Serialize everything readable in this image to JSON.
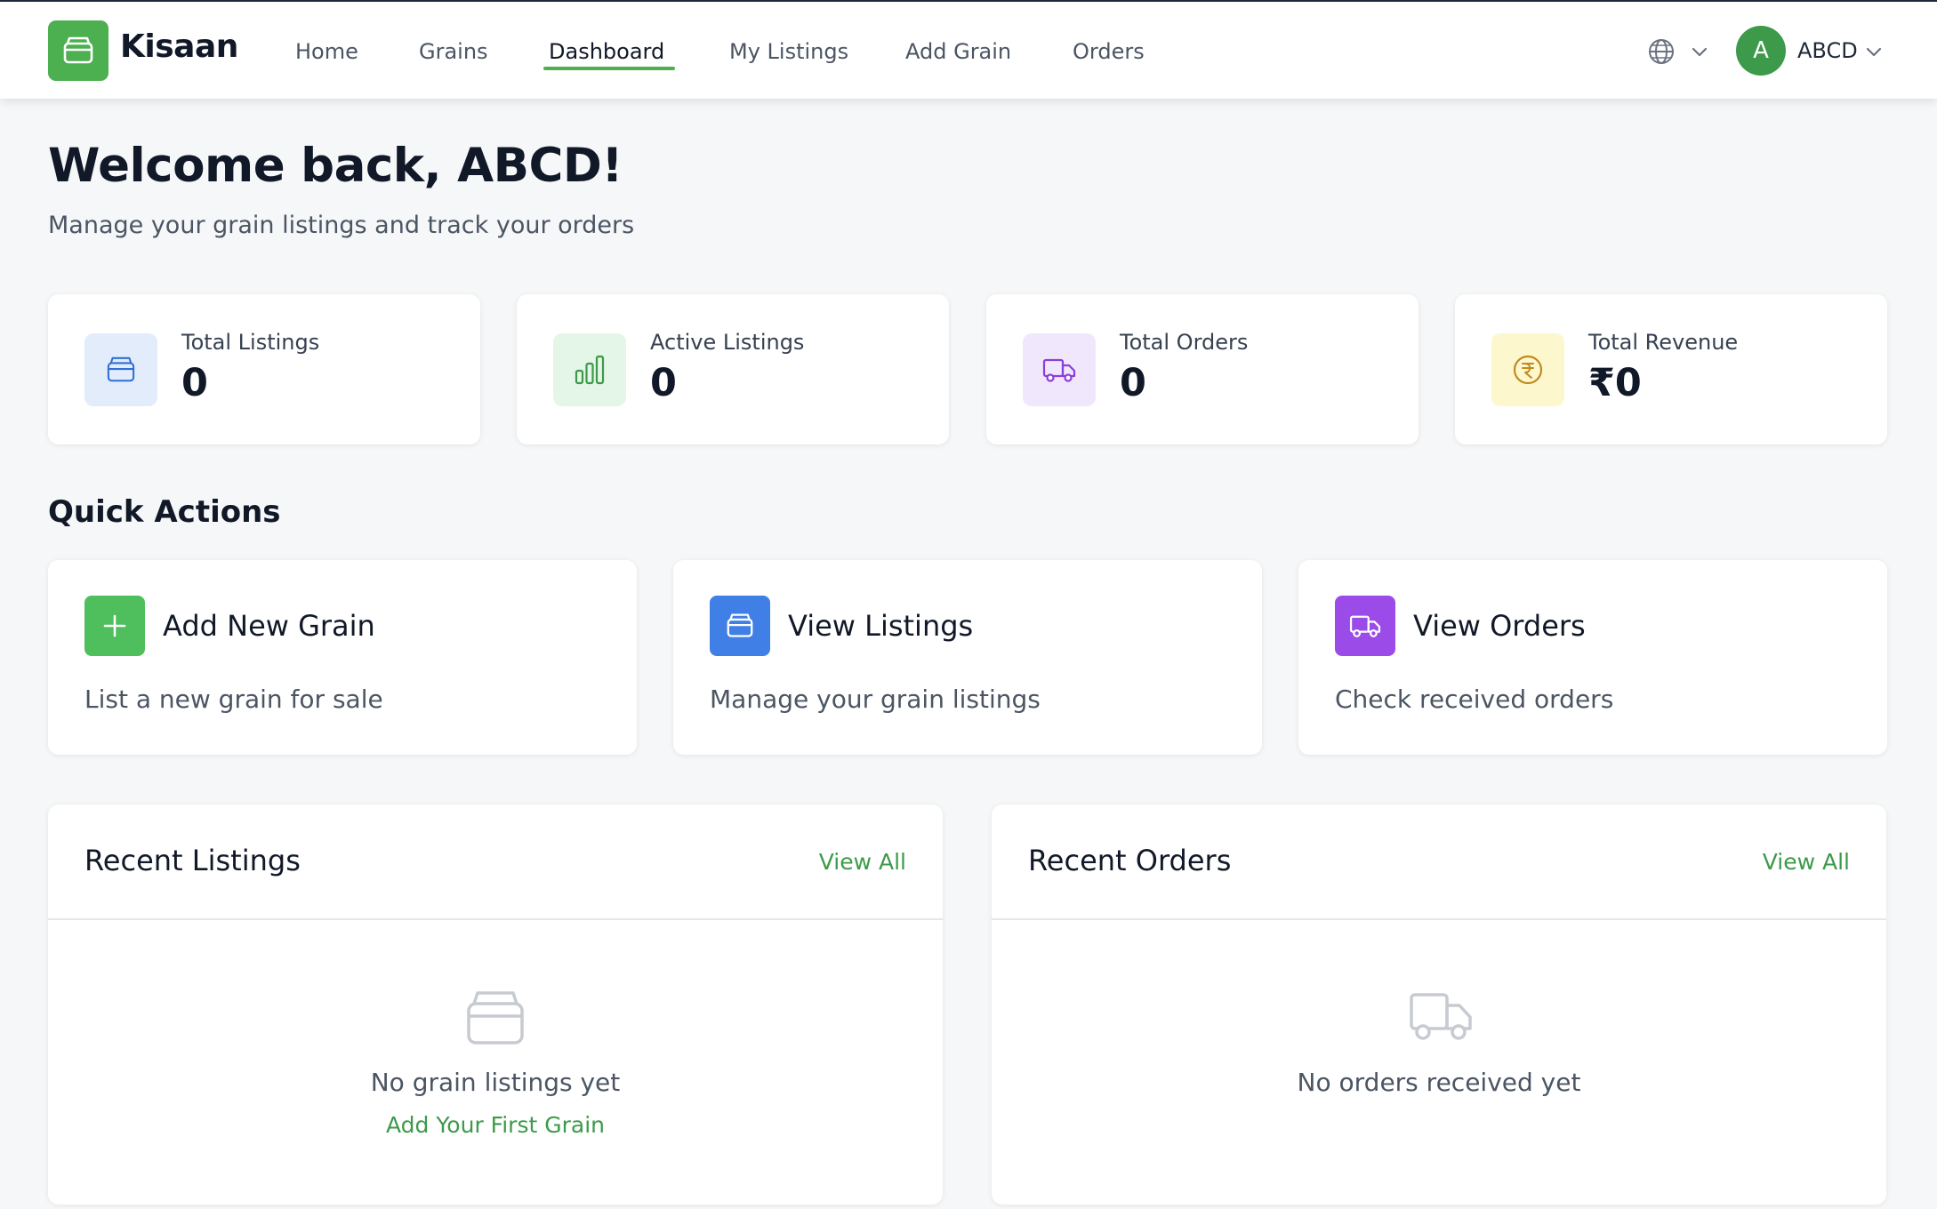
{
  "app": {
    "name": "Kisaan"
  },
  "nav": {
    "items": [
      {
        "label": "Home"
      },
      {
        "label": "Grains"
      },
      {
        "label": "Dashboard",
        "active": true
      },
      {
        "label": "My Listings"
      },
      {
        "label": "Add Grain"
      },
      {
        "label": "Orders"
      }
    ]
  },
  "user": {
    "initial": "A",
    "name": "ABCD"
  },
  "welcome": {
    "title": "Welcome back, ABCD!",
    "subtitle": "Manage your grain listings and track your orders"
  },
  "stats": [
    {
      "label": "Total Listings",
      "value": "0",
      "icon": "grain-icon",
      "color": "#2f6fd6",
      "bg": "#e3ecfb"
    },
    {
      "label": "Active Listings",
      "value": "0",
      "icon": "bar-chart-icon",
      "color": "#3d9a4a",
      "bg": "#e4f6e7"
    },
    {
      "label": "Total Orders",
      "value": "0",
      "icon": "truck-icon",
      "color": "#8b3fd9",
      "bg": "#f1e7fc"
    },
    {
      "label": "Total Revenue",
      "value": "₹0",
      "icon": "rupee-icon",
      "color": "#c08a1e",
      "bg": "#fdf7cd"
    }
  ],
  "quick_actions": {
    "title": "Quick Actions",
    "items": [
      {
        "title": "Add New Grain",
        "desc": "List a new grain for sale",
        "icon": "plus-icon",
        "color": "#4fbe5c"
      },
      {
        "title": "View Listings",
        "desc": "Manage your grain listings",
        "icon": "grain-icon",
        "color": "#3f7fe6"
      },
      {
        "title": "View Orders",
        "desc": "Check received orders",
        "icon": "truck-icon",
        "color": "#9a4be8"
      }
    ]
  },
  "recent_listings": {
    "title": "Recent Listings",
    "view_all": "View All",
    "empty_text": "No grain listings yet",
    "empty_link": "Add Your First Grain"
  },
  "recent_orders": {
    "title": "Recent Orders",
    "view_all": "View All",
    "empty_text": "No orders received yet"
  },
  "colors": {
    "accent": "#4caf50",
    "link": "#3d9a4a"
  }
}
